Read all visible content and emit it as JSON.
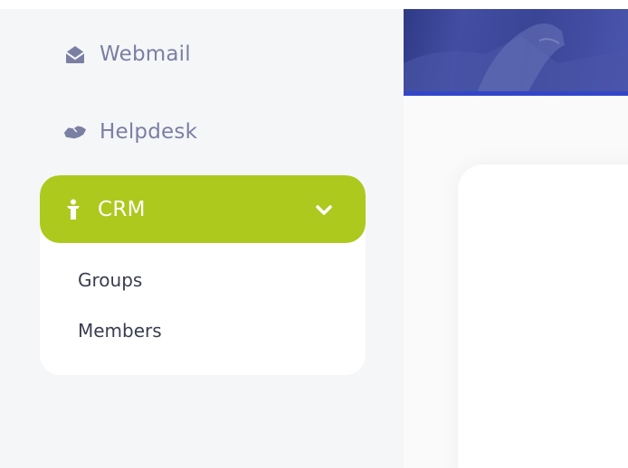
{
  "sidebar": {
    "items": [
      {
        "label": "Webmail",
        "icon": "envelope-open-icon"
      },
      {
        "label": "Helpdesk",
        "icon": "handshake-icon"
      }
    ],
    "crm": {
      "label": "CRM",
      "icon": "person-icon",
      "expanded": true,
      "accent_color": "#aec91e",
      "children": [
        {
          "label": "Groups"
        },
        {
          "label": "Members"
        }
      ]
    }
  },
  "colors": {
    "sidebar_bg": "#f5f6f8",
    "nav_text": "#7b7fa3",
    "banner_accent": "#3346c9"
  }
}
